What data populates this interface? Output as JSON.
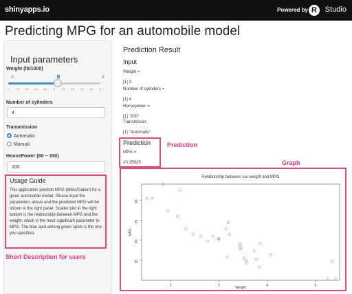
{
  "topbar": {
    "brand": "shinyapps.io",
    "powered_by": "Powered by",
    "r_logo": "R",
    "rstudio": "Studio"
  },
  "app_title": "Predicting MPG for an automobile model",
  "sidebar": {
    "title": "Input parameters",
    "weight": {
      "label": "Weight (lb/1000)",
      "min": "1",
      "max": "5",
      "value": "3",
      "fraction": 0.5,
      "ticks": [
        "1",
        "1.4",
        "1.8",
        "2.2",
        "2.6",
        "3",
        "3.4",
        "3.8",
        "4.2",
        "4.6",
        "5"
      ]
    },
    "cylinders": {
      "label": "Number of cylinders",
      "value": "4"
    },
    "transmission": {
      "label": "Transmission",
      "options": [
        "Automatic",
        "Manual"
      ],
      "selected": "Automatic"
    },
    "horsepower": {
      "label": "HousePower (60 ~ 330)",
      "value": "200"
    },
    "guide": {
      "title": "Usage Guide",
      "text": "This application predicts MPG (Miles/Gallon) for a given automobile model. Please input the parameters above and the predicted MPG will be shown in the right panel. Scatter plot in the right bottom is the relationship between MPG and the weight, which is the most significant parameter to MPG. The blue spot among green spots is the one you specified."
    }
  },
  "main": {
    "result_title": "Prediction Result",
    "input_title": "Input",
    "lines": [
      "Weight =",
      "[1] 3",
      "Number of cylinders =",
      "[1] 4",
      "Horsepower =",
      "[1] \"200\"",
      "Transmision:",
      "[1] \"Automatic\""
    ],
    "prediction": {
      "title": "Prediction",
      "label": "MPG =",
      "value": "20.35625"
    }
  },
  "annotations": {
    "prediction": "Prediction",
    "graph": "Graph",
    "guide": "Short Description for users"
  },
  "colors": {
    "annotation": "#e23479",
    "point": "#8fd18f",
    "highlight": "#428bca"
  },
  "chart_data": {
    "type": "scatter",
    "title": "Relationship between car weight and MPG",
    "xlabel": "Weight",
    "ylabel": "MPG",
    "x_ticks": [
      2,
      3,
      4,
      5
    ],
    "y_ticks": [
      15,
      20,
      25,
      30
    ],
    "xlim": [
      1.4,
      5.5
    ],
    "ylim": [
      10,
      34
    ],
    "points": [
      [
        1.51,
        30.4
      ],
      [
        1.62,
        30.4
      ],
      [
        1.84,
        33.9
      ],
      [
        1.94,
        27.3
      ],
      [
        2.14,
        26.0
      ],
      [
        2.2,
        32.4
      ],
      [
        2.32,
        22.8
      ],
      [
        2.47,
        21.5
      ],
      [
        2.62,
        21.0
      ],
      [
        2.77,
        19.7
      ],
      [
        2.88,
        21.0
      ],
      [
        3.15,
        22.8
      ],
      [
        3.17,
        15.8
      ],
      [
        3.19,
        24.4
      ],
      [
        3.22,
        21.4
      ],
      [
        3.44,
        18.7
      ],
      [
        3.44,
        19.2
      ],
      [
        3.44,
        17.8
      ],
      [
        3.46,
        18.1
      ],
      [
        3.52,
        15.5
      ],
      [
        3.57,
        15.0
      ],
      [
        3.57,
        14.3
      ],
      [
        3.73,
        17.3
      ],
      [
        3.78,
        15.2
      ],
      [
        3.84,
        13.3
      ],
      [
        3.85,
        19.2
      ],
      [
        4.07,
        16.4
      ],
      [
        5.25,
        10.4
      ],
      [
        5.34,
        14.7
      ],
      [
        5.42,
        10.4
      ]
    ],
    "highlight": {
      "x": 3,
      "y": 20.35625
    }
  }
}
